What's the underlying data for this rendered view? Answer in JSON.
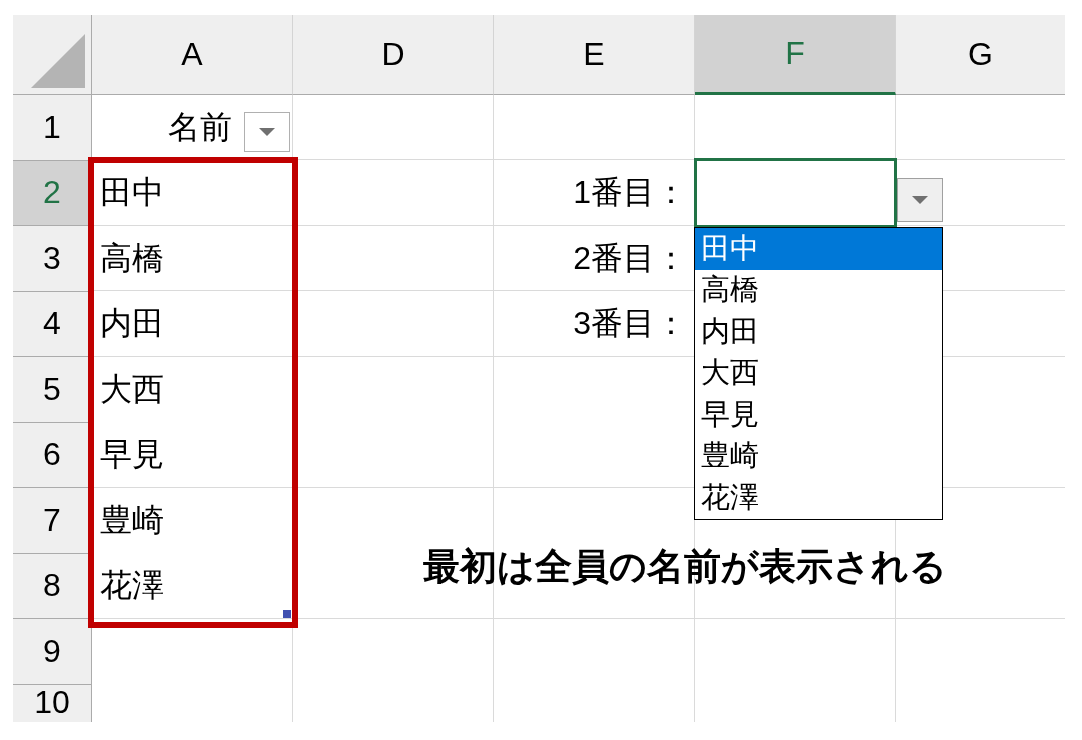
{
  "columns": [
    {
      "label": "A",
      "selected": false
    },
    {
      "label": "D",
      "selected": false
    },
    {
      "label": "E",
      "selected": false
    },
    {
      "label": "F",
      "selected": true
    },
    {
      "label": "G",
      "selected": false
    }
  ],
  "rows": [
    {
      "label": "1",
      "selected": false,
      "column_a": "名前",
      "column_a_filter": true
    },
    {
      "label": "2",
      "selected": true,
      "column_a": "田中",
      "column_e": "1番目："
    },
    {
      "label": "3",
      "selected": false,
      "column_a": "高橋",
      "column_e": "2番目："
    },
    {
      "label": "4",
      "selected": false,
      "column_a": "内田",
      "column_e": "3番目："
    },
    {
      "label": "5",
      "selected": false,
      "column_a": "大西"
    },
    {
      "label": "6",
      "selected": false,
      "column_a": "早見"
    },
    {
      "label": "7",
      "selected": false,
      "column_a": "豊崎"
    },
    {
      "label": "8",
      "selected": false,
      "column_a": "花澤"
    },
    {
      "label": "9",
      "selected": false
    },
    {
      "label": "10",
      "selected": false
    }
  ],
  "dropdown": {
    "open": true,
    "items": [
      {
        "label": "田中",
        "selected": true
      },
      {
        "label": "高橋",
        "selected": false
      },
      {
        "label": "内田",
        "selected": false
      },
      {
        "label": "大西",
        "selected": false
      },
      {
        "label": "早見",
        "selected": false
      },
      {
        "label": "豊崎",
        "selected": false
      },
      {
        "label": "花澤",
        "selected": false
      }
    ]
  },
  "annotation": "最初は全員の名前が表示される"
}
